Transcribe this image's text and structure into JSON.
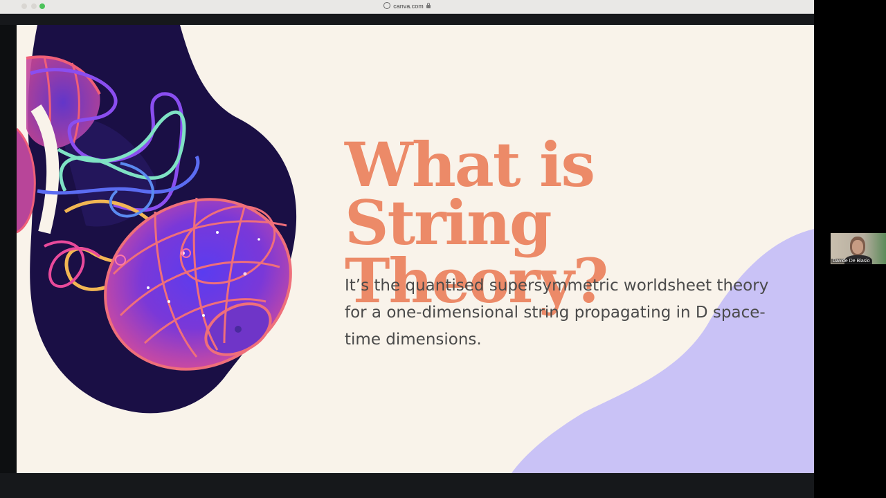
{
  "browser": {
    "url": "canva.com"
  },
  "slide": {
    "title_line1": "What is String",
    "title_line2": "Theory?",
    "body": "It’s the quantised supersymmetric worldsheet theory for a one-dimensional string propagating in D space-time dimensions.",
    "colors": {
      "background": "#f9f3ea",
      "title": "#ec8a68",
      "body": "#4a4a4a",
      "lilac": "#c9c2f6",
      "space": "#1a0f45"
    }
  },
  "participant": {
    "name": "Davide De Biasio"
  }
}
